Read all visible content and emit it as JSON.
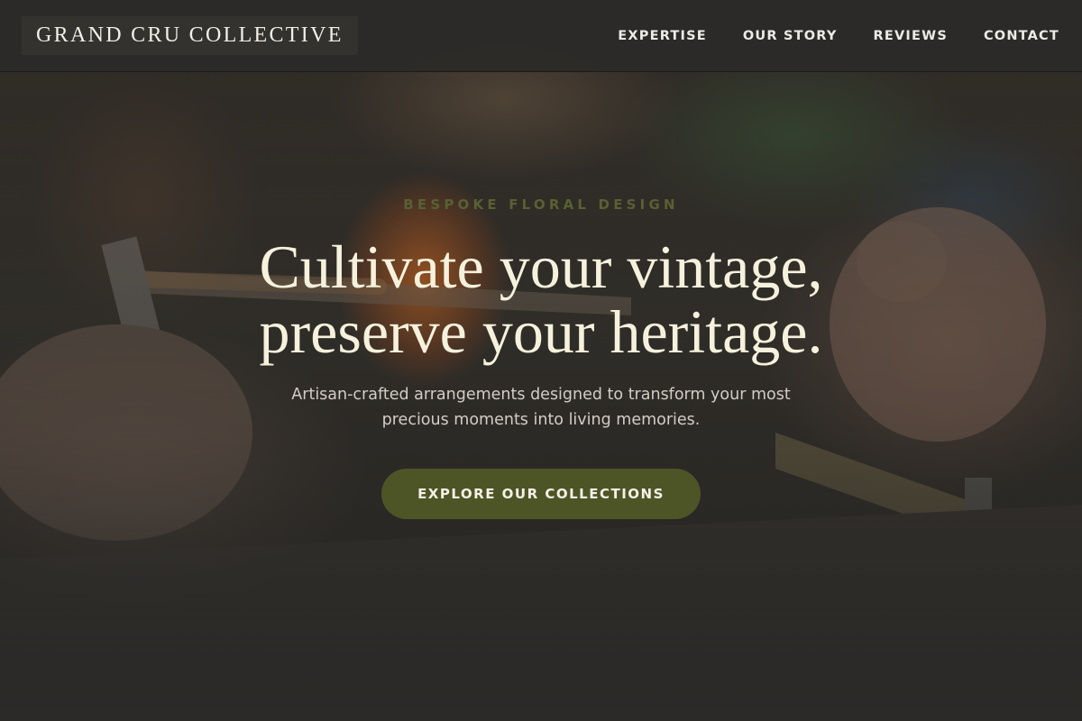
{
  "navbar": {
    "brand": "GRAND CRU COLLECTIVE",
    "links": [
      "EXPERTISE",
      "OUR STORY",
      "REVIEWS",
      "CONTACT"
    ]
  },
  "hero": {
    "eyebrow": "BESPOKE FLORAL DESIGN",
    "headline_line1": "Cultivate your vintage,",
    "headline_line2": "preserve your heritage.",
    "subtext": "Artisan-crafted arrangements designed to transform your most precious moments into living memories.",
    "cta_label": "EXPLORE OUR COLLECTIONS",
    "background": "blurred-workshop-photo"
  },
  "colors": {
    "nav_bg": "#2c2b29",
    "headline": "#f6f1dc",
    "eyebrow": "#586132",
    "cta_bg": "#4d5526",
    "cta_text": "#f4f1e6"
  }
}
